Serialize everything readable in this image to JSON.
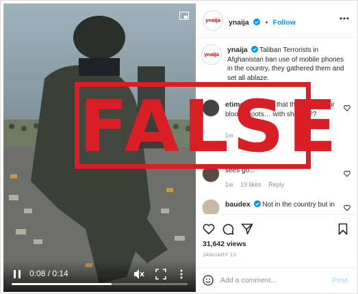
{
  "video": {
    "time": "0:08 / 0:14",
    "progress": 0.57
  },
  "post": {
    "username": "ynaija",
    "avatar_logo": "ynaija",
    "follow_label": "Follow",
    "separator": "•",
    "caption": "Taliban Terrorists in Afghanistan ban use of mobile phones in the country, they gathered them and set all ablaze.",
    "comments": [
      {
        "username": "etimoffiong",
        "text": "So that they'd get their blood shoots… with shades??",
        "meta": {
          "time": "1w",
          "likes": "",
          "reply": ""
        }
      },
      {
        "username": "",
        "text": "sees go...",
        "meta": {
          "time": "1w",
          "likes": "19 likes",
          "reply": "Reply"
        }
      },
      {
        "username": "baudex",
        "text": "Not in the country but in",
        "meta": {
          "time": "",
          "likes": "",
          "reply": ""
        }
      }
    ],
    "views": "31,642 views",
    "date": "JANUARY 13"
  },
  "composer": {
    "placeholder": "Add a comment...",
    "post_label": "Post"
  },
  "stamp": {
    "label": "FALSE"
  },
  "icons": {
    "verified": "verified-badge-icon",
    "heart": "heart-icon",
    "comment": "comment-icon",
    "share": "share-icon",
    "save": "bookmark-icon",
    "emoji": "emoji-icon",
    "more": "more-options-icon"
  },
  "colors": {
    "accent": "#0095f6",
    "stamp": "#d81f26",
    "post_disabled": "#b2dffc"
  }
}
